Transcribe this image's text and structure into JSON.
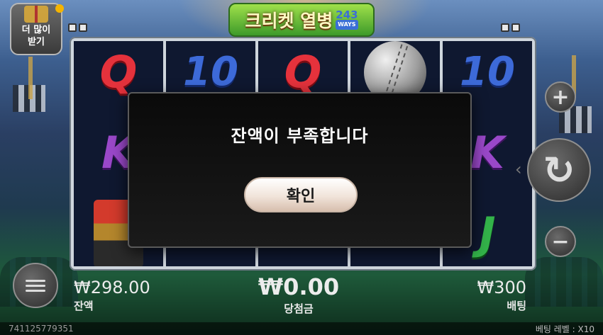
{
  "game": {
    "title": "크리켓 열병",
    "ways_count": "243",
    "ways_label": "WAYS"
  },
  "buy_button": {
    "label": "더 많이\n받기",
    "icon": "gift-icon"
  },
  "reels": [
    [
      "Q",
      "K",
      "player"
    ],
    [
      "10",
      "",
      ""
    ],
    [
      "Q",
      "",
      ""
    ],
    [
      "ball",
      "",
      ""
    ],
    [
      "10",
      "K",
      "J"
    ]
  ],
  "controls": {
    "plus_icon": "plus-icon",
    "minus_icon": "minus-icon",
    "spin_icon": "refresh-icon",
    "menu_icon": "hamburger-icon",
    "plus_glyph": "+",
    "minus_glyph": "−",
    "spin_glyph": "↻",
    "spin_arrow_glyph": "‹"
  },
  "status": {
    "balance_value": "₩298.00",
    "balance_label": "잔액",
    "win_value": "₩0.00",
    "win_label": "당첨금",
    "bet_value": "₩300",
    "bet_label": "배팅"
  },
  "footer": {
    "session_id": "741125779351",
    "bet_level": "베팅 레벨 : X10"
  },
  "modal": {
    "message": "잔액이 부족합니다",
    "confirm_label": "확인"
  },
  "colors": {
    "accent_green": "#3d9a2a",
    "notify_dot": "#f5b400"
  }
}
